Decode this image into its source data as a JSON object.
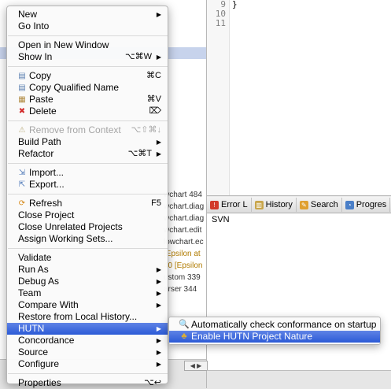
{
  "background": {
    "tree_lines": [
      "",
      "",
      "",
      "",
      "",
      "",
      "",
      ""
    ],
    "editor_line_numbers": [
      "9",
      "10",
      "11"
    ],
    "editor_code": "}",
    "view_tabs": [
      {
        "label": "Error L",
        "icon": "error-icon",
        "color": "#d23a2a"
      },
      {
        "label": "History",
        "icon": "history-icon",
        "color": "#c8a54a"
      },
      {
        "label": "Search",
        "icon": "search-icon",
        "color": "#e0a030"
      },
      {
        "label": "Progres",
        "icon": "progress-icon",
        "color": "#4a7fc8"
      }
    ],
    "panel_label": "SVN",
    "console_lines": [
      {
        "text": "wchart 484",
        "highlight": false
      },
      {
        "text": "wchart.diag",
        "highlight": false
      },
      {
        "text": "wchart.diag",
        "highlight": false
      },
      {
        "text": "wchart.edit",
        "highlight": false
      },
      {
        "text": "lowchart.ec",
        "highlight": false
      },
      {
        "text": "[Epsilon at",
        "highlight": true
      },
      {
        "text": "40 [Epsilon",
        "highlight": true
      },
      {
        "text": "ustom 339",
        "highlight": false
      },
      {
        "text": "arser 344",
        "highlight": false
      }
    ],
    "scroll_arrows": "◀ ▶"
  },
  "context_menu": {
    "items": [
      {
        "label": "New",
        "submenu": true
      },
      {
        "label": "Go Into"
      },
      {
        "sep": true
      },
      {
        "label": "Open in New Window"
      },
      {
        "label": "Show In",
        "shortcut": "⌥⌘W",
        "submenu": true
      },
      {
        "sep": true
      },
      {
        "label": "Copy",
        "shortcut": "⌘C",
        "icon": "copy-icon"
      },
      {
        "label": "Copy Qualified Name",
        "icon": "copy-qualified-icon"
      },
      {
        "label": "Paste",
        "shortcut": "⌘V",
        "icon": "paste-icon"
      },
      {
        "label": "Delete",
        "shortcut": "⌦",
        "icon": "delete-icon"
      },
      {
        "sep": true
      },
      {
        "label": "Remove from Context",
        "shortcut": "⌥⇧⌘↓",
        "icon": "remove-context-icon",
        "disabled": true
      },
      {
        "label": "Build Path",
        "submenu": true
      },
      {
        "label": "Refactor",
        "shortcut": "⌥⌘T",
        "submenu": true
      },
      {
        "sep": true
      },
      {
        "label": "Import...",
        "icon": "import-icon"
      },
      {
        "label": "Export...",
        "icon": "export-icon"
      },
      {
        "sep": true
      },
      {
        "label": "Refresh",
        "shortcut": "F5",
        "icon": "refresh-icon"
      },
      {
        "label": "Close Project"
      },
      {
        "label": "Close Unrelated Projects"
      },
      {
        "label": "Assign Working Sets..."
      },
      {
        "sep": true
      },
      {
        "label": "Validate"
      },
      {
        "label": "Run As",
        "submenu": true
      },
      {
        "label": "Debug As",
        "submenu": true
      },
      {
        "label": "Team",
        "submenu": true
      },
      {
        "label": "Compare With",
        "submenu": true
      },
      {
        "label": "Restore from Local History..."
      },
      {
        "label": "HUTN",
        "submenu": true,
        "highlighted": true
      },
      {
        "label": "Concordance",
        "submenu": true
      },
      {
        "label": "Source",
        "submenu": true
      },
      {
        "label": "Configure",
        "submenu": true
      },
      {
        "sep": true
      },
      {
        "label": "Properties",
        "shortcut": "⌥↩"
      }
    ]
  },
  "hutn_submenu": {
    "items": [
      {
        "label": "Automatically check conformance on startup",
        "icon": "magnifier-icon"
      },
      {
        "label": "Enable HUTN Project Nature",
        "icon": "nature-icon",
        "highlighted": true
      }
    ]
  }
}
